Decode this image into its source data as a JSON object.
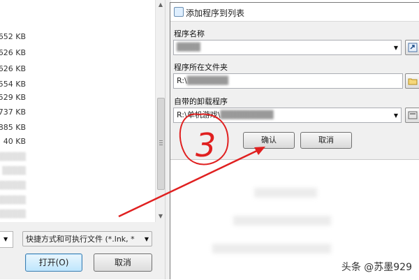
{
  "file_dialog": {
    "file_sizes": [
      "652 KB",
      "626 KB",
      "626 KB",
      "554 KB",
      "529 KB",
      "737 KB",
      "885 KB",
      "40 KB"
    ],
    "file_type_filter": "快捷方式和可执行文件 (*.lnk, *",
    "open_button": "打开(O)",
    "cancel_button": "取消"
  },
  "add_program_dialog": {
    "title": "添加程序到列表",
    "program_name_label": "程序名称",
    "program_folder_label": "程序所在文件夹",
    "program_folder_value": "R:\\",
    "uninstaller_label": "自带的卸载程序",
    "uninstaller_value": "R:\\单机游戏\\",
    "ok_button": "确认",
    "cancel_button": "取消"
  },
  "annotation": {
    "step_number": "3",
    "annotation_color": "#e02020"
  },
  "watermark": "头条 @苏墨929"
}
